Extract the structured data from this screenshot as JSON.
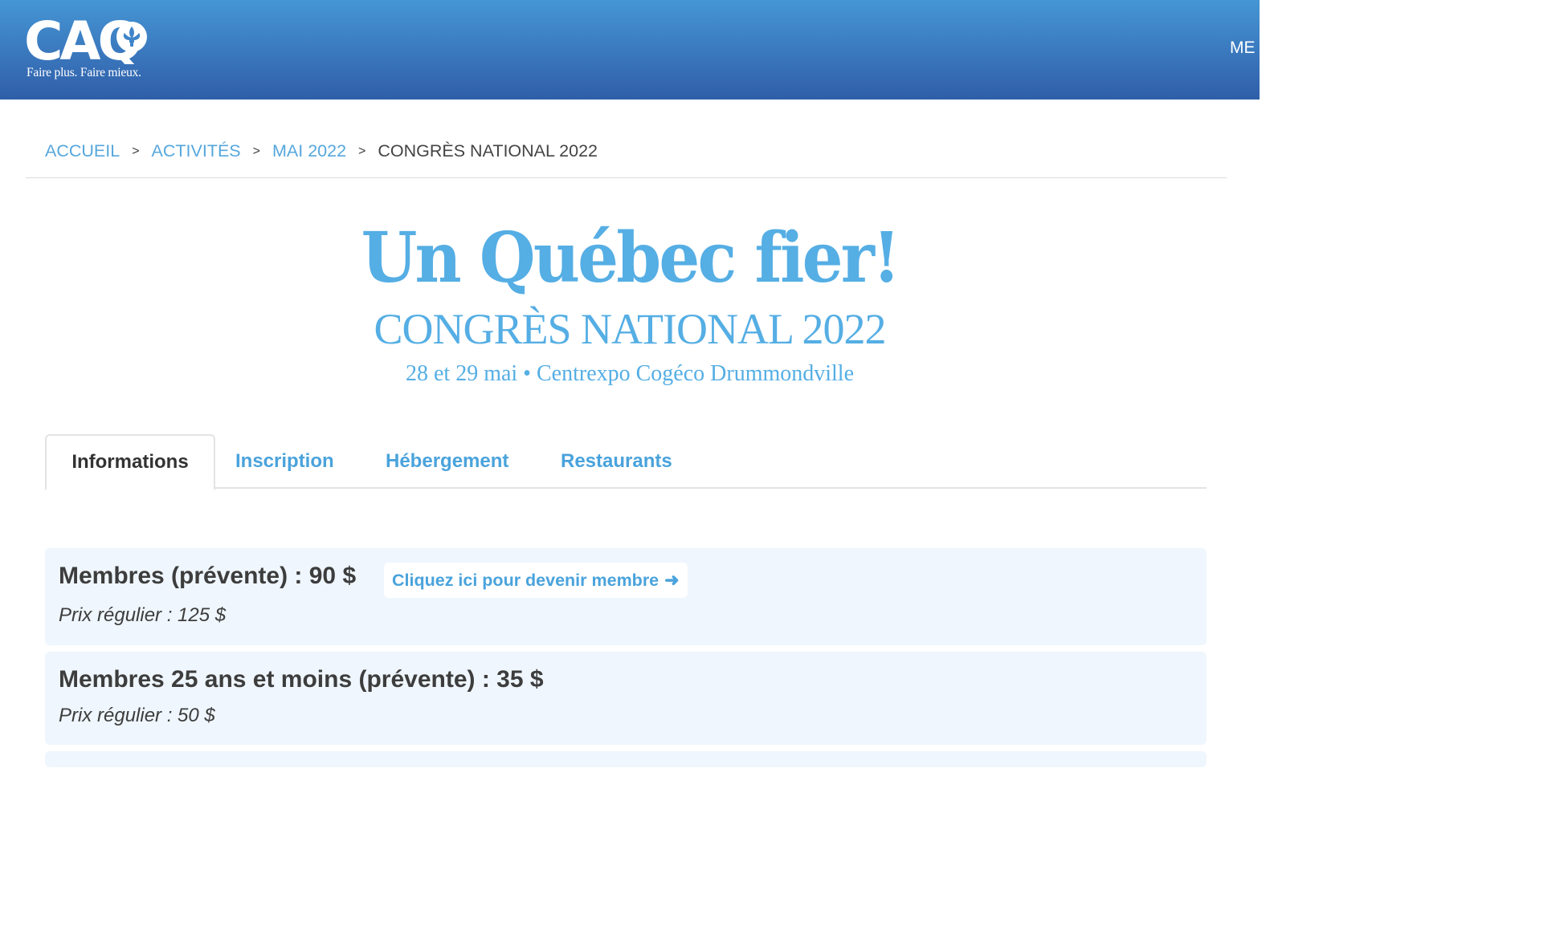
{
  "header": {
    "logo_text": "CAQ",
    "tagline": "Faire plus. Faire mieux.",
    "menu_label": "ME",
    "colors": {
      "header_top": "#4596d4",
      "header_bottom": "#2f5ea8"
    }
  },
  "breadcrumb": {
    "items": [
      "ACCUEIL",
      "ACTIVITÉS",
      "MAI 2022"
    ],
    "separator": ">",
    "current": "CONGRÈS NATIONAL 2022"
  },
  "hero": {
    "title": "Un Québec fier!",
    "subtitle": "CONGRÈS NATIONAL 2022",
    "date_location": "28 et 29 mai • Centrexpo Cogéco Drummondville"
  },
  "tabs": [
    {
      "label": "Informations",
      "active": true
    },
    {
      "label": "Inscription",
      "active": false
    },
    {
      "label": "Hébergement",
      "active": false
    },
    {
      "label": "Restaurants",
      "active": false
    }
  ],
  "pricing": [
    {
      "title": "Membres (prévente) : 90 $",
      "regular": "Prix régulier : 125 $",
      "link_label": "Cliquez ici pour devenir membre",
      "link_icon": "arrow-right-icon"
    },
    {
      "title": "Membres 25 ans et moins (prévente) : 35 $",
      "regular": "Prix régulier : 50 $"
    }
  ],
  "colors": {
    "accent": "#55aee4",
    "link": "#4aa3dc",
    "card_bg": "#eff6fd",
    "text": "#3d3d3d"
  }
}
